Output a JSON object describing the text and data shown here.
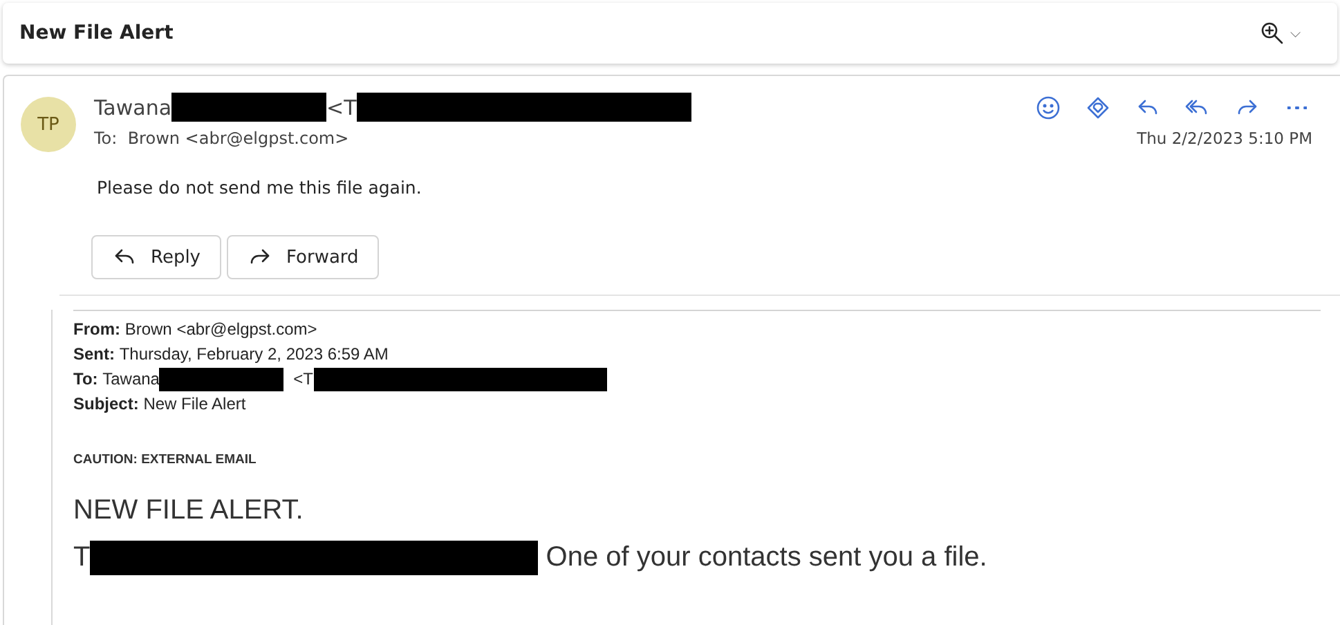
{
  "header": {
    "title": "New File Alert",
    "zoom_menu": "⌵"
  },
  "message": {
    "avatar_initials": "TP",
    "sender_name": "Tawana",
    "sender_address": "<T",
    "to_label": "To:",
    "to_value": "Brown <abr@elgpst.com>",
    "date": "Thu 2/2/2023 5:10 PM",
    "body": "Please do not send me this file again.",
    "actions": [
      {
        "kind": "emoji"
      },
      {
        "kind": "immersive"
      },
      {
        "kind": "reply"
      },
      {
        "kind": "reply_all"
      },
      {
        "kind": "forward"
      },
      {
        "kind": "more"
      }
    ],
    "buttons": [
      {
        "kind": "reply",
        "label": "Reply"
      },
      {
        "kind": "forward",
        "label": "Forward"
      }
    ]
  },
  "quoted": {
    "fields": [
      {
        "label": "From:",
        "value": "Brown <abr@elgpst.com>"
      },
      {
        "label": "Sent:",
        "value": "Thursday, February 2, 2023 6:59 AM"
      },
      {
        "label": "To:",
        "value": "Tawana",
        "address": "<T"
      },
      {
        "label": "Subject:",
        "value": "New File Alert"
      }
    ],
    "caution": "CAUTION: EXTERNAL EMAIL",
    "headline": "NEW FILE ALERT.",
    "line_start": "T",
    "line_end": "One of your contacts sent you a file."
  }
}
